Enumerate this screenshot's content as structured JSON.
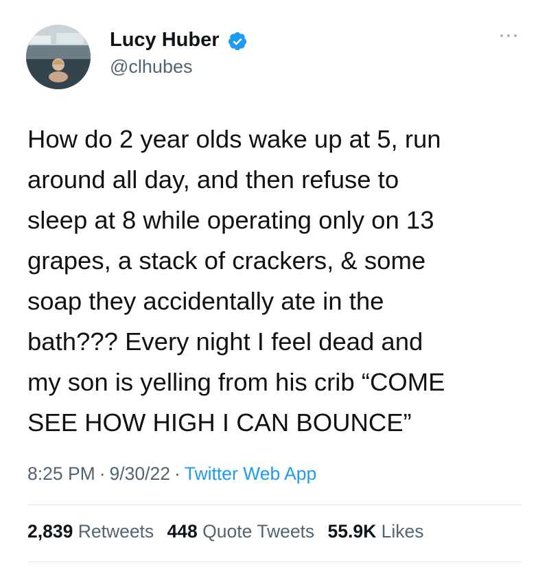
{
  "author": {
    "name": "Lucy Huber",
    "handle": "@clhubes",
    "verified": true
  },
  "tweet": {
    "text": "How do 2 year olds wake up at 5, run\naround all day, and then refuse to\nsleep at 8 while operating only on 13\ngrapes, a stack of crackers, & some\nsoap they accidentally ate in the\nbath??? Every night I feel dead and\nmy son is yelling from his crib “COME\nSEE HOW HIGH I CAN BOUNCE”",
    "time": "8:25 PM",
    "date": "9/30/22",
    "source": "Twitter Web App",
    "separator": "·"
  },
  "stats": {
    "retweets_count": "2,839",
    "retweets_label": "Retweets",
    "quote_count": "448",
    "quote_label": "Quote Tweets",
    "likes_count": "55.9K",
    "likes_label": "Likes"
  },
  "icons": {
    "verified": "verified-badge-icon",
    "more": "more-options-icon"
  },
  "colors": {
    "verified_blue": "#1d9bf0",
    "link_blue": "#1d9bf0",
    "secondary_text": "#536471",
    "divider": "#e3e7ea"
  }
}
